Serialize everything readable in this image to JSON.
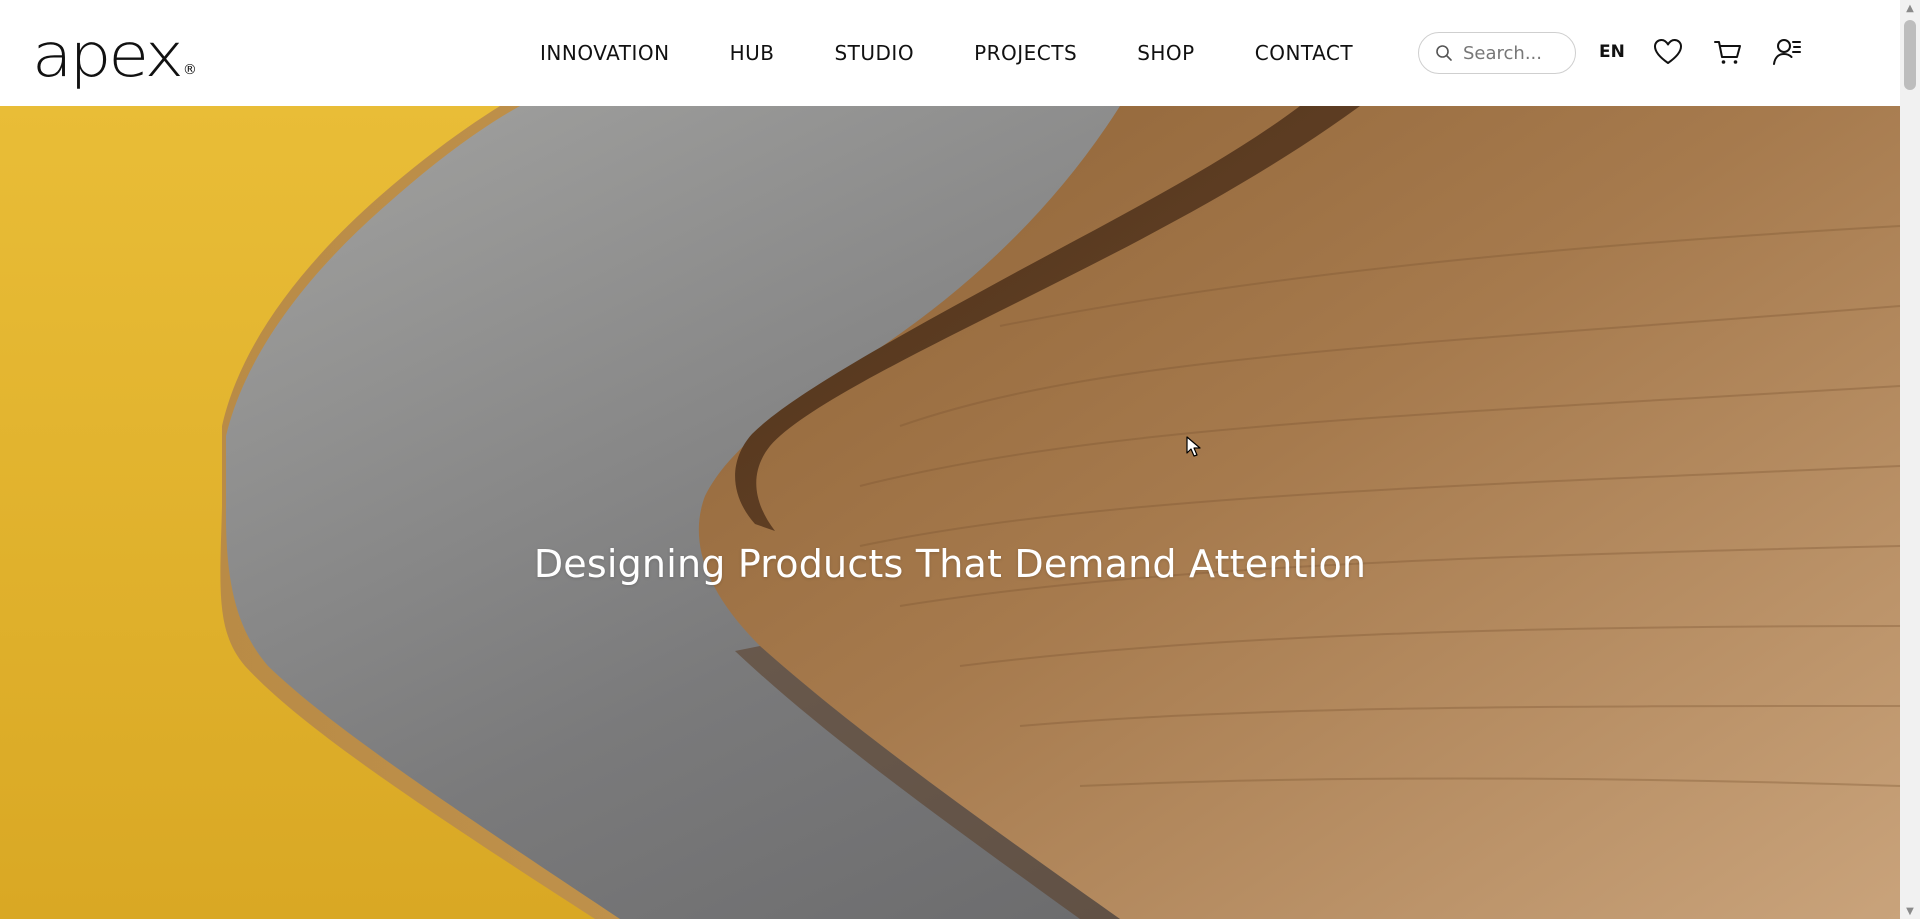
{
  "header": {
    "logo_text": "apex",
    "logo_mark": "®",
    "nav": [
      {
        "label": "INNOVATION"
      },
      {
        "label": "HUB"
      },
      {
        "label": "STUDIO"
      },
      {
        "label": "PROJECTS"
      },
      {
        "label": "SHOP"
      },
      {
        "label": "CONTACT"
      }
    ],
    "search": {
      "placeholder": "Search...",
      "value": "",
      "icon": "search-icon"
    },
    "language": "EN",
    "icons": [
      "heart-icon",
      "cart-icon",
      "account-icon"
    ]
  },
  "hero": {
    "title": "Designing Products That Demand Attention",
    "colors": {
      "background": "#e2b42f",
      "surface": "#7d7d7d",
      "wood": "#9c7148"
    }
  }
}
